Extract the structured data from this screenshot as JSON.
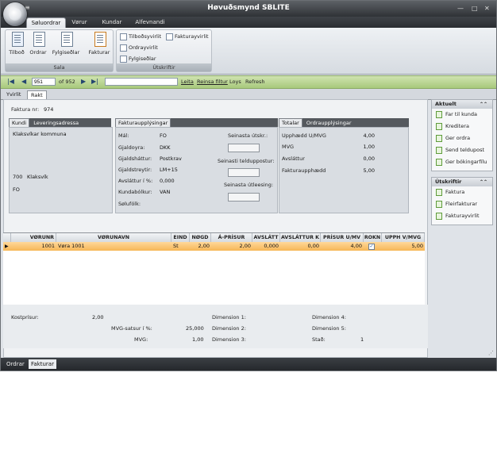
{
  "window": {
    "title": "Høvuðsmynd SBLITE",
    "qat_glyph": "≡"
  },
  "ribbon": {
    "tabs": [
      "Søluordrar",
      "Vørur",
      "Kundar",
      "Alfevnandi"
    ],
    "groups": {
      "sala": {
        "label": "Sala",
        "buttons": [
          "Tilboð",
          "Ordrar",
          "Fylgiseðlar",
          "Fakturar"
        ]
      },
      "utskriftir": {
        "label": "Útskriftir",
        "buttons": [
          "Tilboðsyvirlit",
          "Fakturayvirlit",
          "Ordrayvirlit",
          "Fylgiseðlar"
        ]
      }
    }
  },
  "navigator": {
    "record_value": "951",
    "record_count": "of 952",
    "links": [
      "Leita",
      "Reinsa filtur",
      "Loys",
      "Refresh"
    ]
  },
  "doc_tabs": [
    "Yvirlit",
    "Rakt"
  ],
  "invoice": {
    "number_label": "Faktura nr:",
    "number": "974",
    "customer_tabs": [
      "Kundi",
      "Leveringsadressa"
    ],
    "customer": {
      "name": "Klaksvíkar kommuna",
      "postal_code": "700",
      "city": "Klaksvík",
      "country": "FO"
    },
    "faktura_tab": "Fakturaupplýsingar",
    "fields": [
      {
        "label": "Mál:",
        "value": "FO"
      },
      {
        "label": "Gjaldoyra:",
        "value": "DKK"
      },
      {
        "label": "Gjaldsháttur:",
        "value": "Postkrav"
      },
      {
        "label": "Gjaldstreytir:",
        "value": "LM+15"
      },
      {
        "label": "Avsláttur í %:",
        "value": "0,000"
      },
      {
        "label": "Kundabólkur:",
        "value": "VAN"
      },
      {
        "label": "Sølufólk:",
        "value": ""
      }
    ],
    "print_labels": [
      "Seinasta útskr.:",
      "Seinasti telduppostur:",
      "Seinasta útleesing:"
    ],
    "totals_tabs": [
      "Totalar",
      "Ordraupplýsingar"
    ],
    "totals": [
      {
        "label": "Upphædd U/MVG",
        "value": "4,00"
      },
      {
        "label": "MVG",
        "value": "1,00"
      },
      {
        "label": "Avsláttur",
        "value": "0,00"
      },
      {
        "label": "Fakturaupphædd",
        "value": "5,00"
      }
    ]
  },
  "grid": {
    "columns": [
      "VØRUNR",
      "VØRUNAVN",
      "EIND",
      "NØGD",
      "Á-PRÍSUR",
      "AVSLÁTT",
      "AVSLÁTTUR K",
      "PRÍSUR U/MV",
      "ROKN",
      "UPPH V/MVG"
    ],
    "rows": [
      {
        "vorunr": "1001",
        "vorunavn": "Vøra 1001",
        "eind": "St",
        "nogd": "2,00",
        "aprisur": "2,00",
        "avslatt": "0,000",
        "avslatturk": "0,00",
        "prisur": "4,00",
        "rokn": true,
        "upph": "5,00"
      }
    ]
  },
  "footer_info": {
    "kostprisur_label": "Kostprísur:",
    "kostprisur": "2,00",
    "mvg_satsur_label": "MVG-satsur í %:",
    "mvg_satsur": "25,000",
    "mvg_label": "MVG:",
    "mvg": "1,00",
    "dimensions": [
      "Dimension 1:",
      "Dimension 2:",
      "Dimension 3:",
      "Dimension 4:",
      "Dimension 5:"
    ],
    "stad_label": "Stað:",
    "stad": "1"
  },
  "side": {
    "aktuelt": {
      "title": "Aktuelt",
      "items": [
        "Far til kunda",
        "Kreditera",
        "Ger ordra",
        "Send teldupost",
        "Ger bókingarfílu"
      ]
    },
    "utskriftir": {
      "title": "Útskriftir",
      "items": [
        "Faktura",
        "Fleirfakturar",
        "Fakturayvirlit"
      ]
    }
  },
  "bottom_tabs": [
    "Ordrar",
    "Fakturar"
  ],
  "colors": {
    "accent_row": "#f6b656",
    "nav_green": "#a8c97c",
    "title_dark": "#2f3236"
  }
}
